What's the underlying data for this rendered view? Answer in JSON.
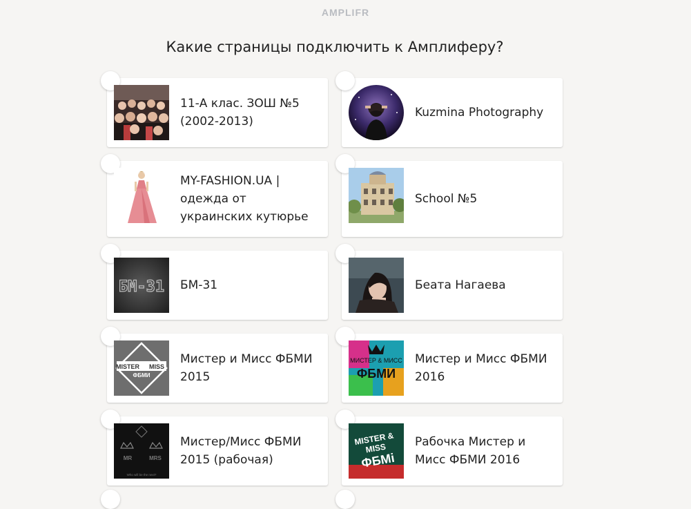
{
  "brand": "AMPLIFR",
  "question": "Какие страницы подключить к Амплиферу?",
  "pages": [
    {
      "name": "11-А клас. ЗОШ №5 (2002-2013)",
      "selected": false,
      "thumb": "group-photo"
    },
    {
      "name": "Kuzmina Photography",
      "selected": false,
      "thumb": "portrait-galaxy"
    },
    {
      "name": "MY-FASHION.UA | одежда от украинских кутюрье",
      "selected": false,
      "thumb": "pink-dress"
    },
    {
      "name": "School №5",
      "selected": false,
      "thumb": "school-building"
    },
    {
      "name": "БМ-31",
      "selected": false,
      "thumb": "bm31-logo",
      "thumb_text": "БМ-31"
    },
    {
      "name": "Беата Нагаева",
      "selected": false,
      "thumb": "woman-portrait"
    },
    {
      "name": "Мистер и Мисс ФБМИ 2015",
      "selected": false,
      "thumb": "mister-miss-2015",
      "thumb_text": [
        "MISTER",
        "MISS",
        "ФБМИ"
      ]
    },
    {
      "name": "Мистер и Мисс ФБМИ 2016",
      "selected": false,
      "thumb": "mister-miss-2016",
      "thumb_text": [
        "МИСТЕР & МИСС",
        "ФБМИ"
      ]
    },
    {
      "name": "Мистер/Мисс ФБМИ 2015 (рабочая)",
      "selected": false,
      "thumb": "mr-mrs-crowns",
      "thumb_text": [
        "MR",
        "MRS",
        "Who will be the next?"
      ]
    },
    {
      "name": "Рабочка Мистер и Мисс ФБМИ 2016",
      "selected": false,
      "thumb": "mister-miss-green",
      "thumb_text": [
        "MISTER &",
        "MISS",
        "ФБМi"
      ]
    }
  ]
}
